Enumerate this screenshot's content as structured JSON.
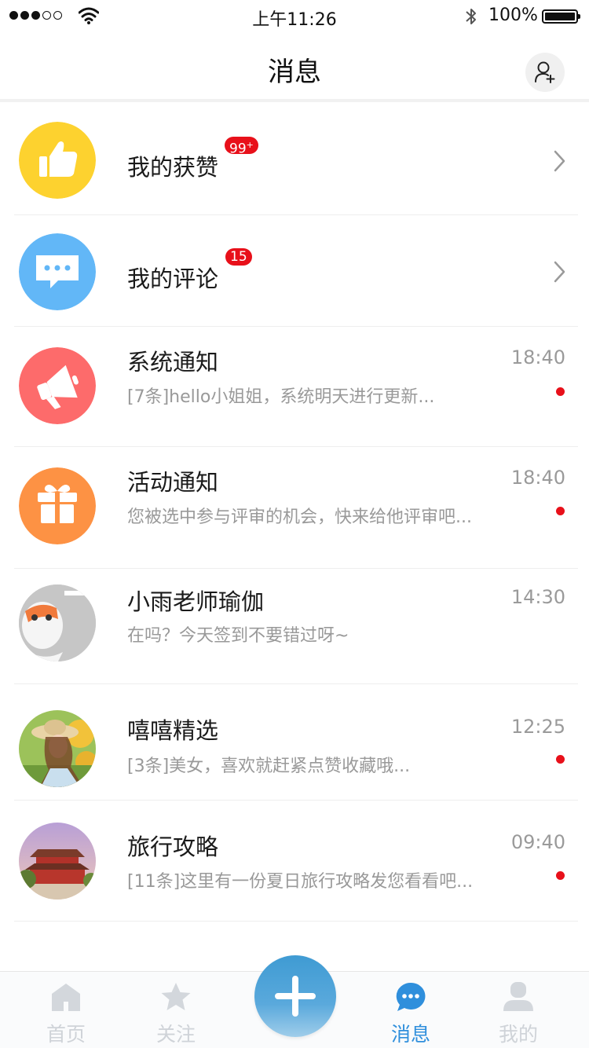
{
  "status_bar": {
    "time": "上午11:26",
    "battery": "100%",
    "signal_bars_filled": 3,
    "signal_bars_total": 5
  },
  "header": {
    "title": "消息",
    "add_friend_icon": "user-plus-icon"
  },
  "messages": [
    {
      "title": "我的获赞",
      "badge": "99",
      "badge_plus": "+",
      "icon": "thumbs-up-icon",
      "color": "#fdd22f"
    },
    {
      "title": "我的评论",
      "badge": "15",
      "icon": "chat-bubble-icon",
      "color": "#62b7f7"
    },
    {
      "title": "系统通知",
      "time": "18:40",
      "preview": "[7条]hello小姐姐，系统明天进行更新...",
      "unread": true,
      "icon": "megaphone-icon",
      "color": "#fd6b6b"
    },
    {
      "title": "活动通知",
      "time": "18:40",
      "preview": "您被选中参与评审的机会，快来给他评审吧...",
      "unread": true,
      "icon": "gift-icon",
      "color": "#fd9244"
    },
    {
      "title": "小雨老师瑜伽",
      "time": "14:30",
      "preview": "在吗？今天签到不要错过呀~",
      "unread": false,
      "icon": "cartoon-avatar"
    },
    {
      "title": "嘻嘻精选",
      "time": "12:25",
      "preview": "[3条]美女，喜欢就赶紧点赞收藏哦...",
      "unread": true,
      "icon": "photo-avatar-girl"
    },
    {
      "title": "旅行攻略",
      "time": "09:40",
      "preview": "[11条]这里有一份夏日旅行攻略发您看看吧...",
      "unread": true,
      "icon": "photo-avatar-palace"
    }
  ],
  "tabs": [
    {
      "label": "首页",
      "icon": "home-icon",
      "active": false
    },
    {
      "label": "关注",
      "icon": "star-icon",
      "active": false
    },
    {
      "label": "消息",
      "icon": "message-icon",
      "active": true
    },
    {
      "label": "我的",
      "icon": "person-icon",
      "active": false
    }
  ],
  "colors": {
    "accent": "#2f8fdc",
    "badge": "#e8101a",
    "tab_inactive": "#cfd3d8"
  }
}
